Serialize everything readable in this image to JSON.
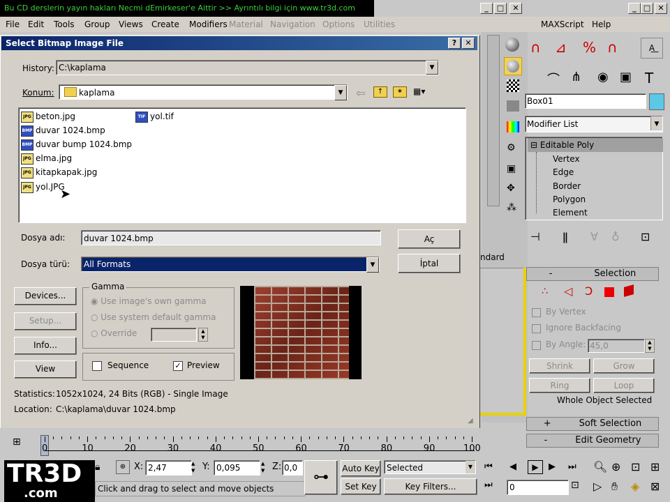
{
  "banner": {
    "text": "Bu CD derslerin yayın hakları Necmi dEmirkeser'e Aittir >> Ayrıntılı bilgi için  www.tr3d.com"
  },
  "menu": {
    "items": [
      "File",
      "Edit",
      "Tools",
      "Group",
      "Views",
      "Create",
      "Modifiers"
    ],
    "disabled": [
      "Material",
      "Navigation",
      "Options",
      "Utilities"
    ],
    "right": [
      "MAXScript",
      "Help"
    ]
  },
  "dialog": {
    "title": "Select Bitmap Image File",
    "history_label": "History:",
    "history_value": "C:\\kaplama",
    "konum_label": "Konum:",
    "konum_value": "kaplama",
    "files": [
      {
        "name": "beton.jpg",
        "type": "JPG"
      },
      {
        "name": "duvar 1024.bmp",
        "type": "BMP"
      },
      {
        "name": "duvar bump 1024.bmp",
        "type": "BMP"
      },
      {
        "name": "elma.jpg",
        "type": "JPG"
      },
      {
        "name": "kitapkapak.jpg",
        "type": "JPG"
      },
      {
        "name": "yol.JPG",
        "type": "JPG"
      },
      {
        "name": "yol.tif",
        "type": "TIF"
      }
    ],
    "filename_label": "Dosya adı:",
    "filename_value": "duvar 1024.bmp",
    "filetype_label": "Dosya türü:",
    "filetype_value": "All Formats",
    "open_button": "Aç",
    "cancel_button": "İptal",
    "devices_button": "Devices...",
    "setup_button": "Setup...",
    "info_button": "Info...",
    "view_button": "View",
    "gamma_label": "Gamma",
    "gamma_options": [
      "Use image's own gamma",
      "Use system default gamma",
      "Override"
    ],
    "sequence_label": "Sequence",
    "preview_label": "Preview",
    "statistics_label": "Statistics:",
    "statistics_value": "1052x1024, 24 Bits (RGB) - Single Image",
    "location_label": "Location:",
    "location_value": "C:\\kaplama\\duvar 1024.bmp"
  },
  "right_panel": {
    "object_name": "Box01",
    "object_color": "#5bc8e6",
    "modifier_list": "Modifier List",
    "stack": [
      "Editable Poly",
      "Vertex",
      "Edge",
      "Border",
      "Polygon",
      "Element"
    ],
    "standard_label": "ndard",
    "selection_rollup": "Selection",
    "by_vertex": "By Vertex",
    "ignore_backfacing": "Ignore Backfacing",
    "by_angle": "By Angle:",
    "by_angle_value": "45,0",
    "shrink": "Shrink",
    "grow": "Grow",
    "ring": "Ring",
    "loop": "Loop",
    "selection_status": "Whole Object Selected",
    "soft_selection": "Soft Selection",
    "edit_geometry": "Edit Geometry",
    "plus": "+",
    "minus": "-"
  },
  "timeline": {
    "ticks": [
      "0",
      "10",
      "20",
      "30",
      "40",
      "50",
      "60",
      "70",
      "80",
      "90",
      "100"
    ]
  },
  "status": {
    "x_label": "X:",
    "x_value": "2,47",
    "y_label": "Y:",
    "y_value": "0,095",
    "z_label": "Z:",
    "z_value": "0,0",
    "auto_key": "Auto Key",
    "set_key": "Set Key",
    "selected": "Selected",
    "key_filters": "Key Filters...",
    "frame_value": "0",
    "prompt": "Click and drag to select and move objects"
  },
  "logo": {
    "text": "TR3D",
    "sub": ".com"
  },
  "colors": {
    "titlebar": "#0a246a",
    "selected": "#0a246a",
    "accent": "#5bc8e6"
  }
}
